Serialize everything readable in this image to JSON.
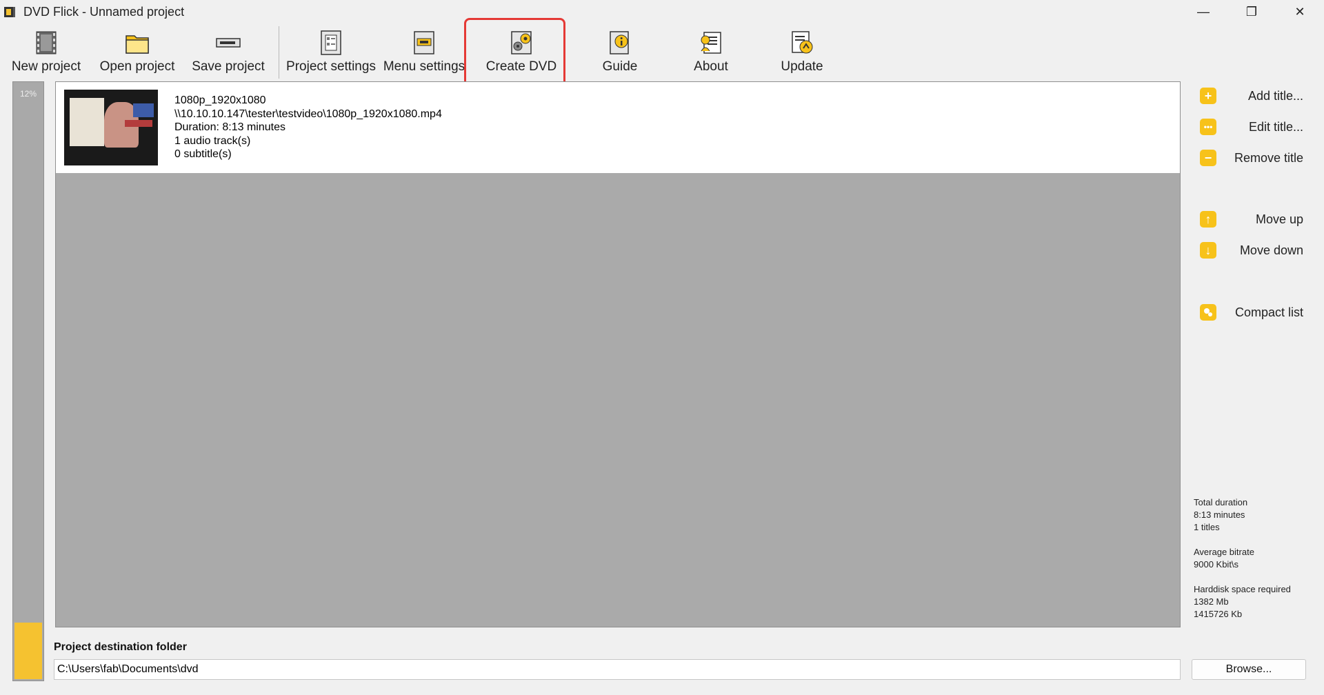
{
  "window": {
    "title": "DVD Flick - Unnamed project",
    "minimize": "—",
    "restore": "❐",
    "close": "✕"
  },
  "toolbar": {
    "items": [
      {
        "label": "New project",
        "icon": "film-icon"
      },
      {
        "label": "Open project",
        "icon": "folder-icon"
      },
      {
        "label": "Save project",
        "icon": "drive-icon"
      },
      {
        "label": "Project settings",
        "icon": "settings-doc-icon"
      },
      {
        "label": "Menu settings",
        "icon": "menu-icon"
      },
      {
        "label": "Create DVD",
        "icon": "gears-icon"
      },
      {
        "label": "Guide",
        "icon": "guide-icon"
      },
      {
        "label": "About",
        "icon": "about-icon"
      },
      {
        "label": "Update",
        "icon": "update-icon"
      }
    ]
  },
  "progress": {
    "label": "12%",
    "fraction": 0.095
  },
  "titles": [
    {
      "name": "1080p_1920x1080",
      "path": "\\\\10.10.10.147\\tester\\testvideo\\1080p_1920x1080.mp4",
      "duration": "Duration: 8:13 minutes",
      "audio": "1 audio track(s)",
      "subtitles": "0 subtitle(s)"
    }
  ],
  "side": {
    "add_title": "Add title...",
    "edit_title": "Edit title...",
    "remove_title": "Remove title",
    "move_up": "Move up",
    "move_down": "Move down",
    "compact_list": "Compact list"
  },
  "stats": {
    "total_duration_label": "Total duration",
    "total_duration": "8:13 minutes",
    "titles_count": "1 titles",
    "avg_bitrate_label": "Average bitrate",
    "avg_bitrate": "9000 Kbit\\s",
    "space_label": "Harddisk space required",
    "space_mb": "1382 Mb",
    "space_kb": "1415726 Kb"
  },
  "destination": {
    "label": "Project destination folder",
    "value": "C:\\Users\\fab\\Documents\\dvd",
    "browse": "Browse..."
  },
  "colors": {
    "accent": "#f7c21a",
    "highlight": "#e53935"
  }
}
